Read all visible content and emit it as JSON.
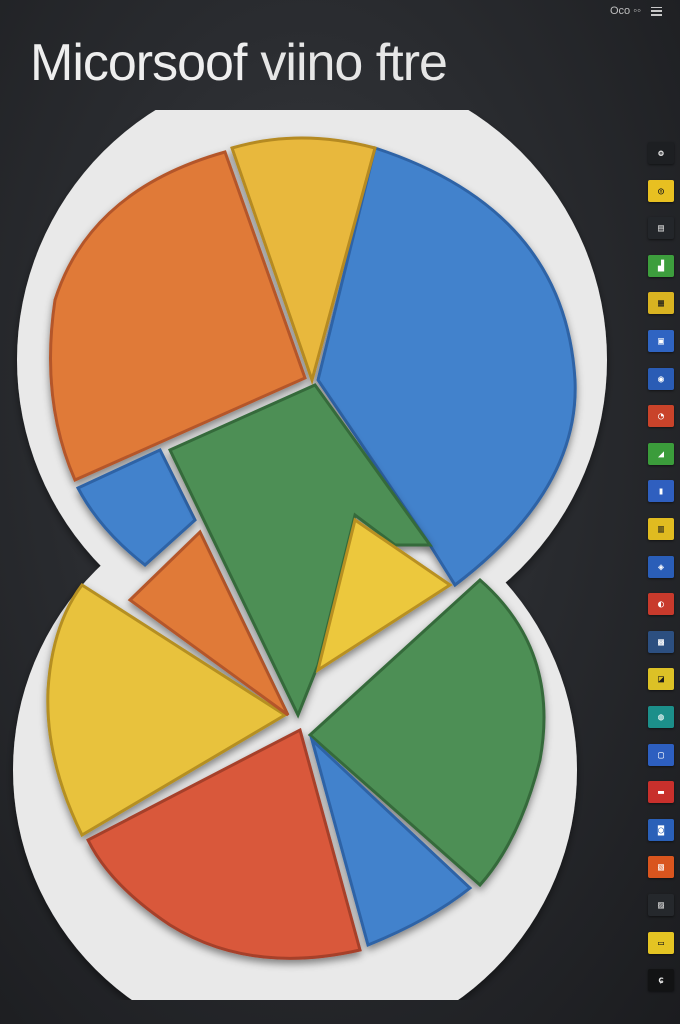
{
  "header": {
    "title_bold": "Micorsoof",
    "title_light": "viino ftre",
    "topbar_text": "Oco ◦◦"
  },
  "illustration": {
    "description_colors": {
      "orange": "#e07a38",
      "yellow": "#e8b83c",
      "blue": "#4282cc",
      "green": "#4e8f55",
      "red": "#d9593a",
      "outline": "#e9e9e9"
    }
  },
  "icon_rail": {
    "items": [
      {
        "name": "app-tile-1-icon",
        "glyph": "ʘ",
        "bg": "#1d1f22",
        "fg": "#d6d6d6"
      },
      {
        "name": "app-tile-2-icon",
        "glyph": "◎",
        "bg": "#e8c021",
        "fg": "#1b1b1b"
      },
      {
        "name": "app-tile-3-icon",
        "glyph": "▤",
        "bg": "#23262a",
        "fg": "#d6d6d6"
      },
      {
        "name": "app-tile-4-icon",
        "glyph": "▟",
        "bg": "#3d9e3d",
        "fg": "#ffffff"
      },
      {
        "name": "app-tile-5-icon",
        "glyph": "▦",
        "bg": "#d9b321",
        "fg": "#1b1b1b"
      },
      {
        "name": "app-tile-6-icon",
        "glyph": "▣",
        "bg": "#2f64c2",
        "fg": "#ffffff"
      },
      {
        "name": "app-tile-7-icon",
        "glyph": "◉",
        "bg": "#2a5cb5",
        "fg": "#ffffff"
      },
      {
        "name": "app-tile-8-icon",
        "glyph": "◔",
        "bg": "#c9432a",
        "fg": "#ffffff"
      },
      {
        "name": "app-tile-9-icon",
        "glyph": "◢",
        "bg": "#3b9c3b",
        "fg": "#ffffff"
      },
      {
        "name": "app-tile-10-icon",
        "glyph": "▮",
        "bg": "#2f5fbf",
        "fg": "#ffffff"
      },
      {
        "name": "app-tile-11-icon",
        "glyph": "▥",
        "bg": "#e0bb20",
        "fg": "#1b1b1b"
      },
      {
        "name": "app-tile-12-icon",
        "glyph": "◈",
        "bg": "#2a5eb8",
        "fg": "#ffffff"
      },
      {
        "name": "app-tile-13-icon",
        "glyph": "◐",
        "bg": "#c83a2c",
        "fg": "#ffffff"
      },
      {
        "name": "app-tile-14-icon",
        "glyph": "▩",
        "bg": "#2c4f80",
        "fg": "#ffffff"
      },
      {
        "name": "app-tile-15-icon",
        "glyph": "◪",
        "bg": "#dcc126",
        "fg": "#1b1b1b"
      },
      {
        "name": "app-tile-16-icon",
        "glyph": "◍",
        "bg": "#1c8f8a",
        "fg": "#ffffff"
      },
      {
        "name": "app-tile-17-icon",
        "glyph": "▢",
        "bg": "#2d5fc0",
        "fg": "#ffffff"
      },
      {
        "name": "app-tile-18-icon",
        "glyph": "▬",
        "bg": "#c8302c",
        "fg": "#ffffff"
      },
      {
        "name": "app-tile-19-icon",
        "glyph": "◙",
        "bg": "#2a60b8",
        "fg": "#ffffff"
      },
      {
        "name": "app-tile-20-icon",
        "glyph": "▧",
        "bg": "#d9551e",
        "fg": "#ffffff"
      },
      {
        "name": "app-tile-21-icon",
        "glyph": "▨",
        "bg": "#25282c",
        "fg": "#d6d6d6"
      },
      {
        "name": "app-tile-22-icon",
        "glyph": "▭",
        "bg": "#e4c423",
        "fg": "#1b1b1b"
      },
      {
        "name": "app-tile-23-icon",
        "glyph": "ɕ",
        "bg": "#121314",
        "fg": "#e6e6e6"
      }
    ]
  }
}
